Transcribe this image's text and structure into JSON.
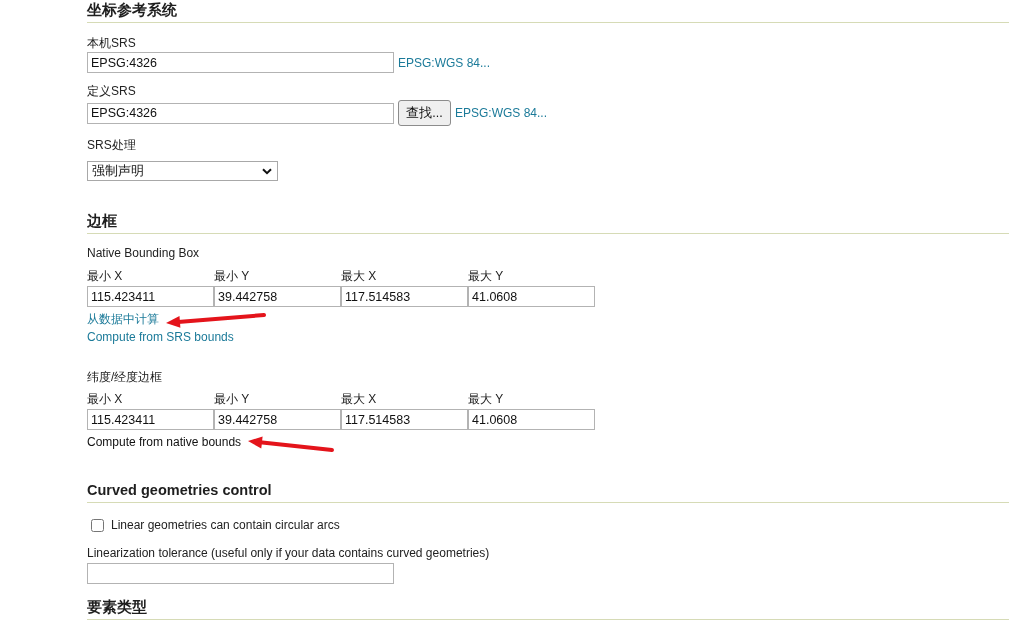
{
  "sections": [
    {
      "title": "坐标参考系统",
      "items": [
        {
          "kind": "field",
          "label": "本机SRS",
          "value": "EPSG:4326",
          "link": "EPSG:WGS 84..."
        },
        {
          "kind": "field",
          "label": "定义SRS",
          "value": "EPSG:4326",
          "button": "查找...",
          "link": "EPSG:WGS 84..."
        },
        {
          "kind": "select",
          "label": "SRS处理",
          "value": "强制声明"
        }
      ]
    },
    {
      "title": "边框",
      "items": [
        {
          "kind": "bbox",
          "label": "Native Bounding Box",
          "columns": [
            {
              "label": "最小 X",
              "value": "115.423411"
            },
            {
              "label": "最小 Y",
              "value": "39.442758"
            },
            {
              "label": "最大 X",
              "value": "117.514583"
            },
            {
              "label": "最大 Y",
              "value": "41.0608"
            }
          ],
          "actions": [
            {
              "kind": "link",
              "text": "从数据中计算",
              "marked": true
            },
            {
              "kind": "link",
              "text": "Compute from SRS bounds",
              "marked": false
            }
          ]
        },
        {
          "kind": "bbox",
          "label": "纬度/经度边框",
          "columns": [
            {
              "label": "最小 X",
              "value": "115.423411"
            },
            {
              "label": "最小 Y",
              "value": "39.442758"
            },
            {
              "label": "最大 X",
              "value": "117.514583"
            },
            {
              "label": "最大 Y",
              "value": "41.0608"
            }
          ],
          "actions": [
            {
              "kind": "plain",
              "text": "Compute from native bounds",
              "marked": true
            }
          ]
        }
      ]
    },
    {
      "title": "Curved geometries control",
      "items": [
        {
          "kind": "checkbox",
          "label": "Linear geometries can contain circular arcs",
          "checked": false
        },
        {
          "kind": "field",
          "label": "Linearization tolerance (useful only if your data contains curved geometries)"
        }
      ]
    },
    {
      "title": "要素类型"
    }
  ]
}
